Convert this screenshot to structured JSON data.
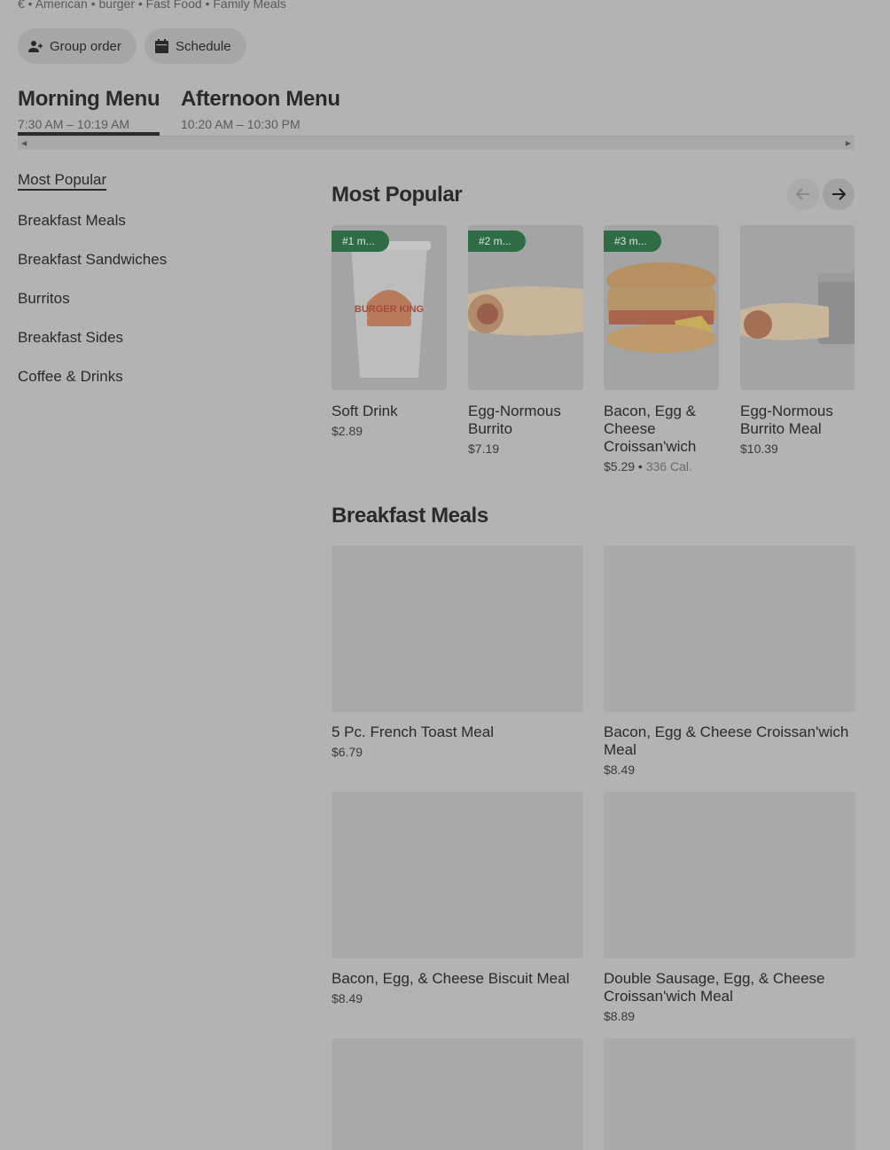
{
  "header": {
    "tags": "€ • American • burger • Fast Food • Family Meals",
    "group_order_label": "Group order",
    "schedule_label": "Schedule"
  },
  "menus": [
    {
      "title": "Morning Menu",
      "hours": "7:30 AM – 10:19 AM"
    },
    {
      "title": "Afternoon Menu",
      "hours": "10:20 AM – 10:30 PM"
    }
  ],
  "sidebar": {
    "items": [
      {
        "label": "Most Popular"
      },
      {
        "label": "Breakfast Meals"
      },
      {
        "label": "Breakfast Sandwiches"
      },
      {
        "label": "Burritos"
      },
      {
        "label": "Breakfast Sides"
      },
      {
        "label": "Coffee & Drinks"
      }
    ]
  },
  "popular": {
    "title": "Most Popular",
    "items": [
      {
        "rank": "#1 m...",
        "name": "Soft Drink",
        "price": "$2.89",
        "calories": ""
      },
      {
        "rank": "#2 m...",
        "name": "Egg-Normous Burrito",
        "price": "$7.19",
        "calories": ""
      },
      {
        "rank": "#3 m...",
        "name": "Bacon, Egg & Cheese Croissan'wich",
        "price": "$5.29",
        "calories": "336 Cal."
      },
      {
        "rank": "",
        "name": "Egg-Normous Burrito Meal",
        "price": "$10.39",
        "calories": ""
      }
    ]
  },
  "breakfast_meals": {
    "title": "Breakfast Meals",
    "items": [
      {
        "name": "5 Pc. French Toast Meal",
        "price": "$6.79"
      },
      {
        "name": "Bacon, Egg & Cheese Croissan'wich Meal",
        "price": "$8.49"
      },
      {
        "name": "Bacon, Egg, & Cheese Biscuit Meal",
        "price": "$8.49"
      },
      {
        "name": "Double Sausage, Egg, & Cheese Croissan'wich Meal",
        "price": "$8.89"
      },
      {
        "name": "",
        "price": ""
      },
      {
        "name": "",
        "price": ""
      }
    ]
  },
  "logo_text": "BURGER KING",
  "colors": {
    "rank_badge": "#2f6b45",
    "overlay": "#b3b3b3"
  },
  "icons": [
    "person-add-icon",
    "calendar-icon",
    "arrow-left-icon",
    "arrow-right-icon"
  ]
}
